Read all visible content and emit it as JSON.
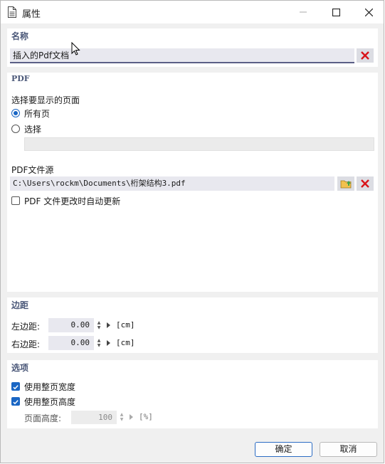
{
  "window": {
    "title": "属性",
    "icon": "document-icon"
  },
  "name_section": {
    "header": "名称",
    "value": "插入的Pdf文档"
  },
  "pdf_section": {
    "header": "PDF",
    "page_select_label": "选择要显示的页面",
    "radio_all_label": "所有页",
    "radio_select_label": "选择",
    "pages_value": "",
    "source_label": "PDF文件源",
    "path_value": "C:\\Users\\rockm\\Documents\\桁架结构3.pdf",
    "auto_update_label": "PDF 文件更改时自动更新"
  },
  "margins": {
    "header": "边距",
    "left_label": "左边距:",
    "left_value": "0.00",
    "right_label": "右边距:",
    "right_value": "0.00",
    "unit": "[cm]"
  },
  "options": {
    "header": "选项",
    "full_width_label": "使用整页宽度",
    "full_height_label": "使用整页高度",
    "page_height_label": "页面高度:",
    "page_height_value": "100",
    "page_height_unit": "[%]"
  },
  "footer": {
    "ok": "确定",
    "cancel": "取消"
  },
  "colors": {
    "accent": "#1a66c4",
    "header_text": "#4a5778",
    "delete_red": "#d9141a",
    "folder_green": "#4caf50"
  }
}
